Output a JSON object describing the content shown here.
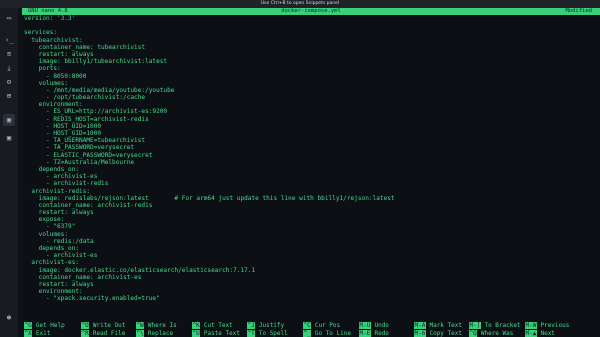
{
  "window": {
    "title": "Use Ctrl+B to open Snippets panel"
  },
  "sidebar": {
    "icons": [
      {
        "name": "folder-icon",
        "glyph": "▭"
      },
      {
        "name": "terminal-icon",
        "glyph": "›_"
      },
      {
        "name": "server-icon",
        "glyph": "≡"
      },
      {
        "name": "download-icon",
        "glyph": "⤓"
      },
      {
        "name": "settings-icon",
        "glyph": "⚙"
      },
      {
        "name": "sessions-icon",
        "glyph": "⊞"
      },
      {
        "name": "active-tab-icon",
        "glyph": "▣",
        "active": true
      },
      {
        "name": "second-tab-icon",
        "glyph": "▣"
      },
      {
        "name": "user-icon",
        "glyph": "☻"
      }
    ]
  },
  "editor": {
    "app_name": "GNU nano 4.8",
    "file_name": "docker-compose.yml",
    "status": "Modified",
    "lines": [
      "version: '3.3'",
      "",
      "services:",
      "  tubearchivist:",
      "    container_name: tubearchivist",
      "    restart: always",
      "    image: bbilly1/tubearchivist:latest",
      "    ports:",
      "      - 8050:8000",
      "    volumes:",
      "      - /mnt/media/media/youtube:/youtube",
      "      - /opt/tubearchivist:/cache",
      "    environment:",
      "      - ES_URL=http://archivist-es:9200",
      "      - REDIS_HOST=archivist-redis",
      "      - HOST_UID=1000",
      "      - HOST_GID=1000",
      "      - TA_USERNAME=tubearchivist",
      "      - TA_PASSWORD=verysecret",
      "      - ELASTIC_PASSWORD=verysecret",
      "      - TZ=Australia/Melbourne",
      "    depends_on:",
      "      - archivist-es",
      "      - archivist-redis",
      "  archivist-redis:",
      "    image: redislabs/rejson:latest       # For arm64 just update this line with bbilly1/rejson:latest",
      "    container_name: archivist-redis",
      "    restart: always",
      "    expose:",
      "      - \"6379\"",
      "    volumes:",
      "      - redis:/data",
      "    depends_on:",
      "      - archivist-es",
      "  archivist-es:",
      "    image: docker.elastic.co/elasticsearch/elasticsearch:7.17.1",
      "    container_name: archivist-es",
      "    restart: always",
      "    environment:",
      "      - \"xpack.security.enabled=true\""
    ]
  },
  "help": [
    {
      "key": "^G",
      "label": "Get Help"
    },
    {
      "key": "^X",
      "label": "Exit"
    },
    {
      "key": "^O",
      "label": "Write Out"
    },
    {
      "key": "^R",
      "label": "Read File"
    },
    {
      "key": "^W",
      "label": "Where Is"
    },
    {
      "key": "^\\",
      "label": "Replace"
    },
    {
      "key": "^K",
      "label": "Cut Text"
    },
    {
      "key": "^U",
      "label": "Paste Text"
    },
    {
      "key": "^J",
      "label": "Justify"
    },
    {
      "key": "^T",
      "label": "To Spell"
    },
    {
      "key": "^C",
      "label": "Cur Pos"
    },
    {
      "key": "^_",
      "label": "Go To Line"
    },
    {
      "key": "M-U",
      "label": "Undo"
    },
    {
      "key": "M-E",
      "label": "Redo"
    },
    {
      "key": "M-A",
      "label": "Mark Text"
    },
    {
      "key": "M-6",
      "label": "Copy Text"
    },
    {
      "key": "M-]",
      "label": "To Bracket"
    },
    {
      "key": "^Q",
      "label": "Where Was"
    },
    {
      "key": "M-W",
      "label": "Previous"
    },
    {
      "key": "M-▲",
      "label": "Next"
    }
  ],
  "colors": {
    "terminal_text": "#46dc8c",
    "titlebar_bg": "#39d07d",
    "terminal_bg": "#0c0f14"
  }
}
